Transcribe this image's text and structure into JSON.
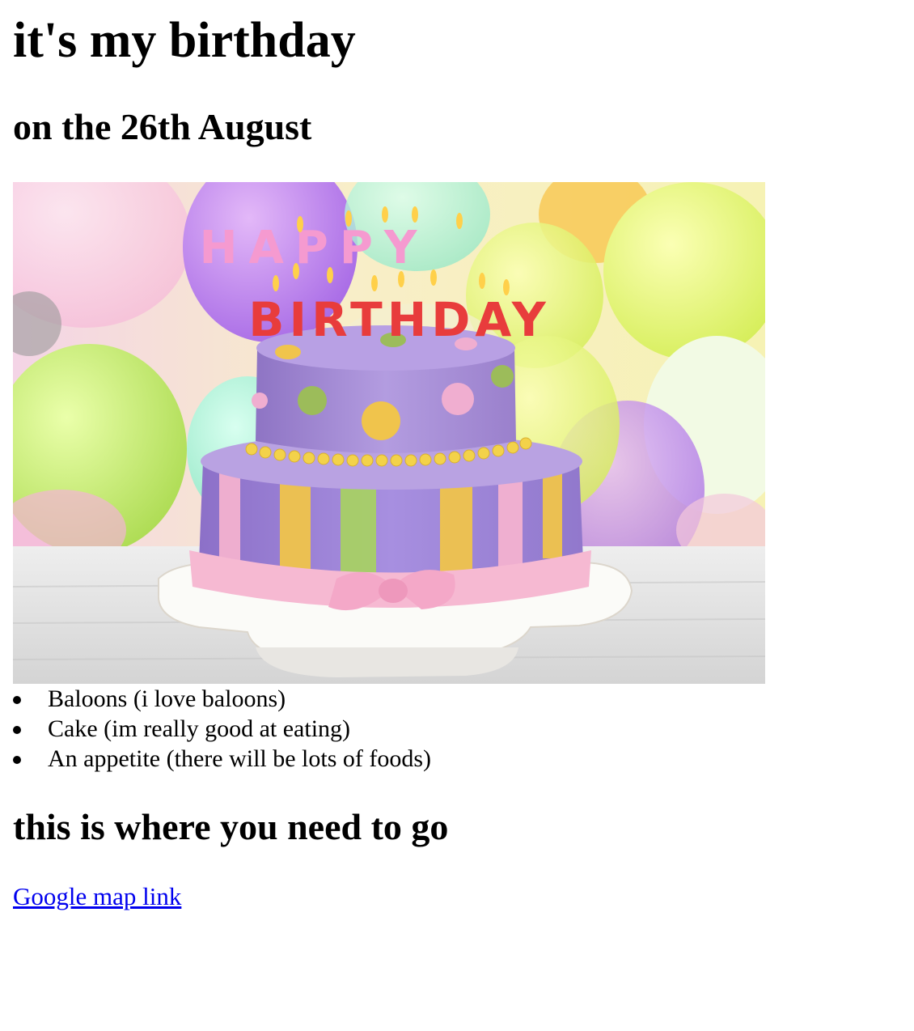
{
  "heading": "it's my birthday",
  "subheading": "on the 26th August",
  "photo": {
    "subject": "birthday-cake-photo",
    "candle_line_1": "HAPPY",
    "candle_line_2": "BIRTHDAY"
  },
  "bring_list": [
    "Baloons (i love baloons)",
    "Cake (im really good at eating)",
    "An appetite (there will be lots of foods)"
  ],
  "location_heading": "this is where you need to go",
  "map_link": {
    "label": "Google map link"
  },
  "colors": {
    "link": "#0000ee",
    "text": "#000000"
  }
}
